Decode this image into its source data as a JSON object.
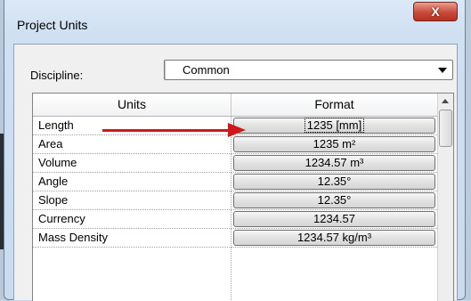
{
  "window": {
    "title": "Project Units",
    "close_glyph": "X"
  },
  "discipline": {
    "label": "Discipline:",
    "value": "Common"
  },
  "grid": {
    "headers": {
      "units": "Units",
      "format": "Format"
    },
    "rows": [
      {
        "unit": "Length",
        "format": "1235 [mm]"
      },
      {
        "unit": "Area",
        "format": "1235 m²"
      },
      {
        "unit": "Volume",
        "format": "1234.57 m³"
      },
      {
        "unit": "Angle",
        "format": "12.35°"
      },
      {
        "unit": "Slope",
        "format": "12.35°"
      },
      {
        "unit": "Currency",
        "format": "1234.57"
      },
      {
        "unit": "Mass Density",
        "format": "1234.57 kg/m³"
      }
    ]
  },
  "annotation": {
    "arrow_color": "#d01818"
  },
  "icons": {
    "close": "close-icon",
    "dropdown": "chevron-down-icon",
    "scroll_up": "scroll-up-icon"
  }
}
